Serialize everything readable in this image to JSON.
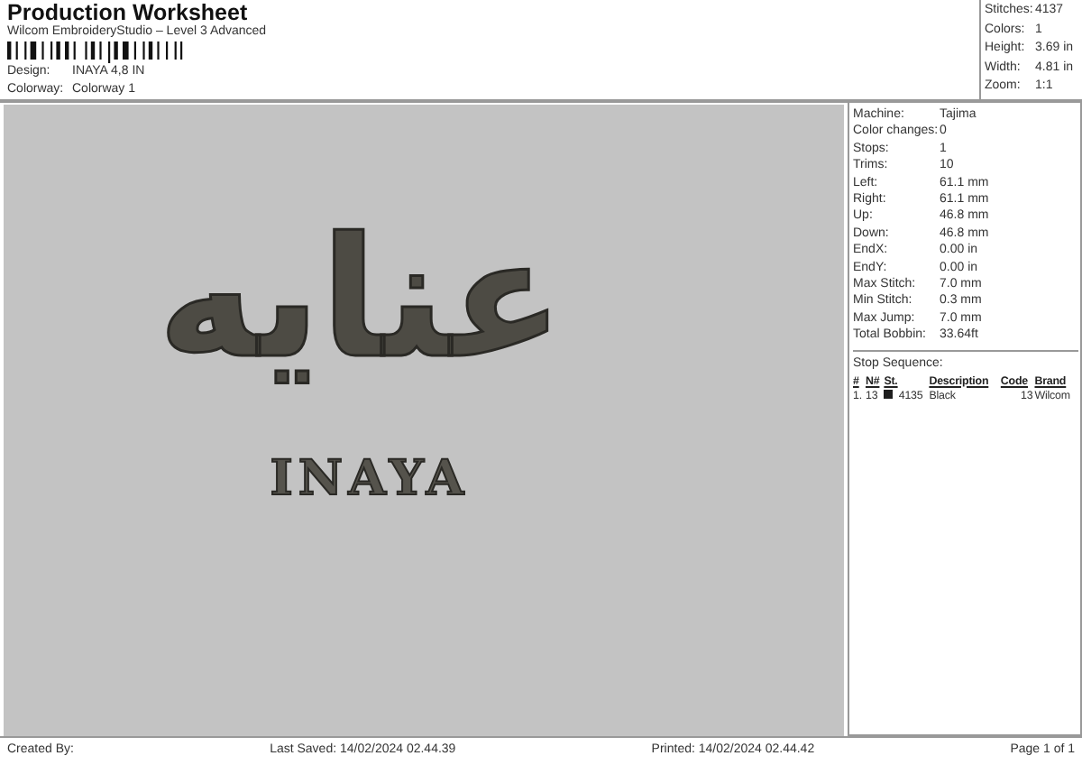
{
  "header": {
    "title": "Production Worksheet",
    "subtitle": "Wilcom EmbroideryStudio – Level 3 Advanced",
    "fields": [
      {
        "label": "Design:",
        "value": "INAYA 4,8 IN"
      },
      {
        "label": "Colorway:",
        "value": "Colorway 1"
      }
    ]
  },
  "summary": [
    {
      "label": "Stitches:",
      "value": "4137"
    },
    {
      "label": "Colors:",
      "value": "1"
    },
    {
      "label": "Height:",
      "value": "3.69 in"
    },
    {
      "label": "Width:",
      "value": "4.81 in"
    },
    {
      "label": "Zoom:",
      "value": "1:1"
    }
  ],
  "design": {
    "arabic_text": "عنايه",
    "latin_text": "INAYA"
  },
  "details": [
    {
      "label": "Machine:",
      "value": "Tajima"
    },
    {
      "label": "Color changes:",
      "value": "0"
    },
    {
      "label": "Stops:",
      "value": "1"
    },
    {
      "label": "Trims:",
      "value": "10"
    },
    {
      "label": "Left:",
      "value": "61.1 mm"
    },
    {
      "label": "Right:",
      "value": "61.1 mm"
    },
    {
      "label": "Up:",
      "value": "46.8 mm"
    },
    {
      "label": "Down:",
      "value": "46.8 mm"
    },
    {
      "label": "EndX:",
      "value": "0.00 in"
    },
    {
      "label": "EndY:",
      "value": "0.00 in"
    },
    {
      "label": "Max Stitch:",
      "value": "7.0 mm"
    },
    {
      "label": "Min Stitch:",
      "value": "0.3 mm"
    },
    {
      "label": "Max Jump:",
      "value": "7.0 mm"
    },
    {
      "label": "Total Bobbin:",
      "value": "33.64ft"
    }
  ],
  "stop_sequence": {
    "title": "Stop Sequence:",
    "columns": [
      "#",
      "N#",
      "St.",
      "Description",
      "Code",
      "Brand"
    ],
    "rows": [
      {
        "index": "1.",
        "needle": "13",
        "color": "#1e1e1e",
        "stitches": "4135",
        "description": "Black",
        "code": "13",
        "brand": "Wilcom"
      }
    ]
  },
  "footer": {
    "created_by": "Created By:",
    "last_saved": "Last Saved: 14/02/2024 02.44.39",
    "printed": "Printed: 14/02/2024 02.44.42",
    "page": "Page 1 of 1"
  }
}
